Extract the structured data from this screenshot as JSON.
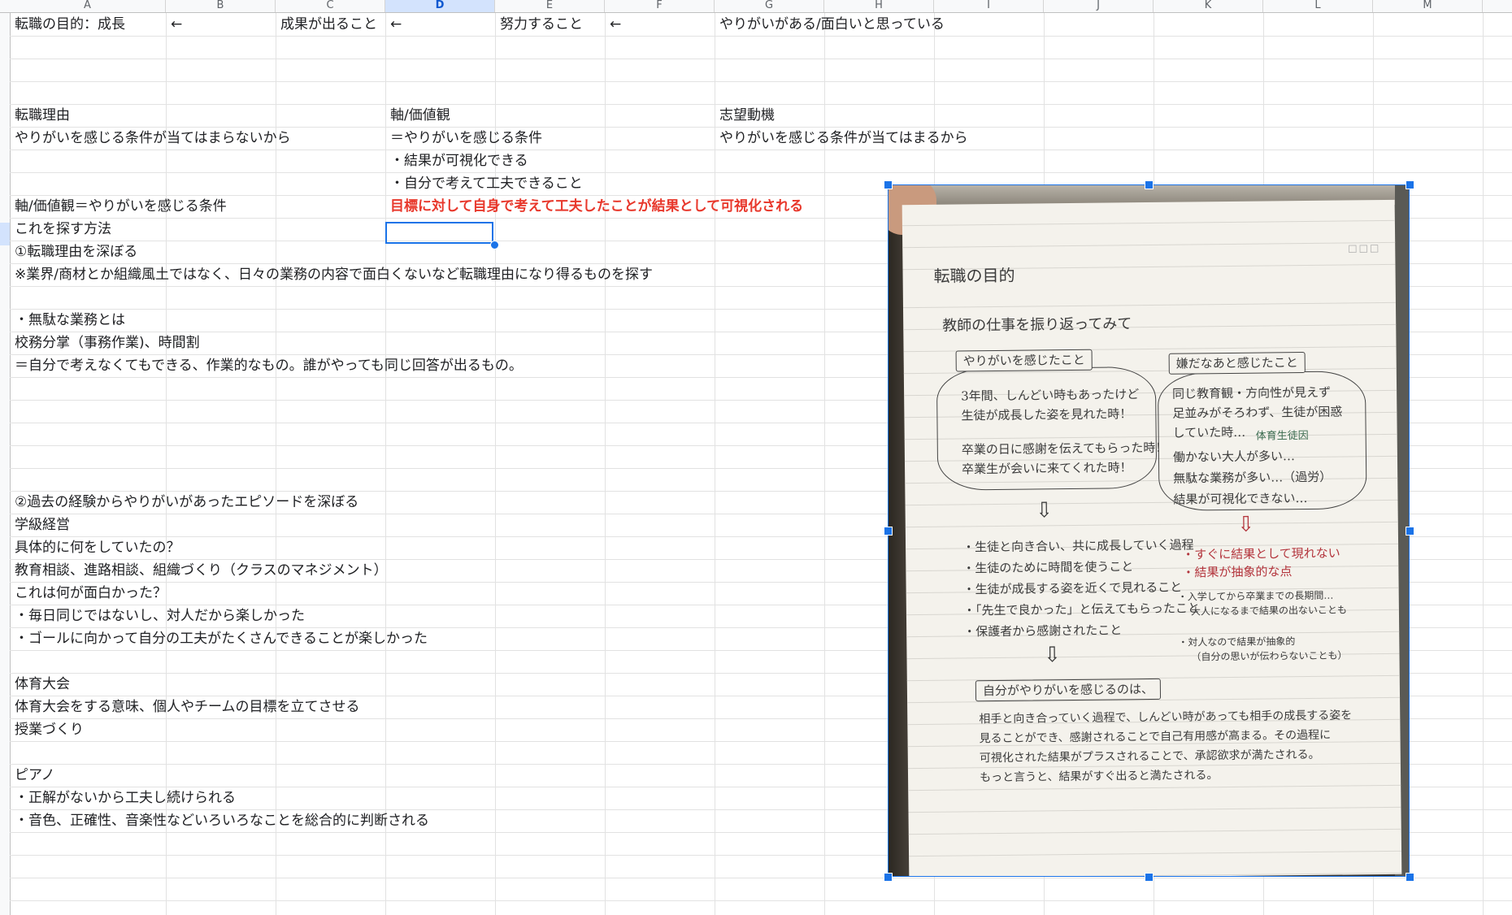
{
  "columns": [
    "A",
    "B",
    "C",
    "D",
    "E",
    "F",
    "G",
    "H",
    "I",
    "J",
    "K",
    "L",
    "M"
  ],
  "selected_column": "D",
  "rows": [
    {
      "A": "転職の目的：成長",
      "B": "←",
      "C": "成果が出ること",
      "D": "←",
      "E": "努力すること",
      "F": "←",
      "G": "やりがいがある/面白いと思っている"
    },
    {
      "A": "転職理由",
      "D": "軸/価値観",
      "G": "志望動機"
    },
    {
      "A": "やりがいを感じる条件が当てはまらないから",
      "D": "＝やりがいを感じる条件",
      "G": "やりがいを感じる条件が当てはまるから"
    },
    {
      "D": "・結果が可視化できる"
    },
    {
      "D": "・自分で考えて工夫できること"
    },
    {
      "A": "軸/価値観＝やりがいを感じる条件",
      "D": "目標に対して自身で考えて工夫したことが結果として可視化される"
    },
    {
      "A": "これを探す方法"
    },
    {
      "A": "①転職理由を深ぼる"
    },
    {
      "A": "※業界/商材とか組織風土ではなく、日々の業務の内容で面白くないなど転職理由になり得るものを探す"
    },
    {
      "A": "・無駄な業務とは"
    },
    {
      "A": "校務分掌（事務作業)、時間割"
    },
    {
      "A": "＝自分で考えなくてもできる、作業的なもの。誰がやっても同じ回答が出るもの。"
    },
    {
      "A": "②過去の経験からやりがいがあったエピソードを深ぼる"
    },
    {
      "A": "学級経営"
    },
    {
      "A": "具体的に何をしていたの？"
    },
    {
      "A": "教育相談、進路相談、組織づくり（クラスのマネジメント）"
    },
    {
      "A": "これは何が面白かった？"
    },
    {
      "A": "・毎日同じではないし、対人だから楽しかった"
    },
    {
      "A": "・ゴールに向かって自分の工夫がたくさんできることが楽しかった"
    },
    {
      "A": "体育大会"
    },
    {
      "A": "体育大会をする意味、個人やチームの目標を立てさせる"
    },
    {
      "A": "授業づくり"
    },
    {
      "A": "ピアノ"
    },
    {
      "A": "・正解がないから工夫し続けられる"
    },
    {
      "A": "・音色、正確性、音楽性などいろいろなことを総合的に判断される"
    }
  ],
  "colors": {
    "red_text": "#e8382c",
    "selection": "#1a73e8"
  },
  "photo_note": {
    "title": "転職の目的",
    "subtitle": "教師の仕事を振り返ってみて",
    "left_label": "やりがいを感じたこと",
    "left_cloud": [
      "3年間、しんどい時もあったけど",
      "生徒が成長した姿を見れた時！",
      "卒業の日に感謝を伝えてもらった時！",
      "卒業生が会いに来てくれた時！"
    ],
    "right_label": "嫌だなあと感じたこと",
    "right_cloud": [
      "同じ教育観・方向性が見えず",
      "足並みがそろわず、生徒が困惑",
      "していた時…",
      "働かない大人が多い…",
      "無駄な業務が多い…（過労）",
      "結果が可視化できない…"
    ],
    "right_note": "体育生徒因",
    "left_bullets": [
      "・生徒と向き合い、共に成長していく過程",
      "・生徒のために時間を使うこと",
      "・生徒が成長する姿を近くで見れること",
      "・「先生で良かった」と伝えてもらったこと",
      "・保護者から感謝されたこと"
    ],
    "right_bullets_red": [
      "・すぐに結果として現れない",
      "・結果が抽象的な点"
    ],
    "right_bullets": [
      "・入学してから卒業までの長期間…",
      "大人になるまで結果の出ないことも",
      "・対人なので結果が抽象的",
      "（自分の思いが伝わらないことも）"
    ],
    "bottom_label": "自分がやりがいを感じるのは、",
    "bottom_text": [
      "相手と向き合っていく過程で、しんどい時があっても相手の成長する姿を",
      "見ることができ、感謝されることで自己有用感が高まる。その過程に",
      "可視化された結果がプラスされることで、承認欲求が満たされる。",
      "もっと言うと、結果がすぐ出ると満たされる。"
    ]
  }
}
